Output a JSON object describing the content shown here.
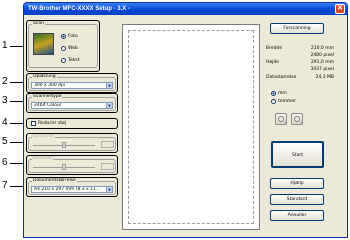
{
  "window": {
    "title": "TW-Brother MFC-XXXX   Setup - 3.X -"
  },
  "callouts": [
    "1",
    "2",
    "3",
    "4",
    "5",
    "6",
    "7"
  ],
  "scan_group": {
    "label": "Scan",
    "options": [
      {
        "label": "Foto",
        "checked": true
      },
      {
        "label": "Web",
        "checked": false
      },
      {
        "label": "Tekst",
        "checked": false
      }
    ]
  },
  "resolution": {
    "label": "Opløsning",
    "value": "300 x 300 dpi"
  },
  "scan_type": {
    "label": "Scannertype",
    "value": "24bit Colour"
  },
  "reduce_noise": {
    "label": "Reducer støj",
    "checked": false
  },
  "brightness": {
    "label": "Lysstyrke"
  },
  "contrast": {
    "label": "Kontrast"
  },
  "doc_size": {
    "label": "Dokumentstørrelse",
    "value": "A4 210 x 297 mm (8.3 x 11..."
  },
  "buttons": {
    "prescan": "Forscanning",
    "start": "Start",
    "help": "Hjælp",
    "default": "Standard",
    "cancel": "Annuller"
  },
  "info": {
    "width_label": "Bredde",
    "width_mm": "210,0 mm",
    "width_px": "2480 pixel",
    "height_label": "Højde",
    "height_mm": "291,0 mm",
    "height_px": "3437 pixel",
    "size_label": "Datastørrelse",
    "size_value": "24,3 MB"
  },
  "units": {
    "options": [
      {
        "label": "mm",
        "checked": true
      },
      {
        "label": "tommer",
        "checked": false
      }
    ]
  },
  "icons": {
    "zoom_in": "zoom-in-icon",
    "zoom_out": "zoom-out-icon",
    "close": "close-icon"
  }
}
